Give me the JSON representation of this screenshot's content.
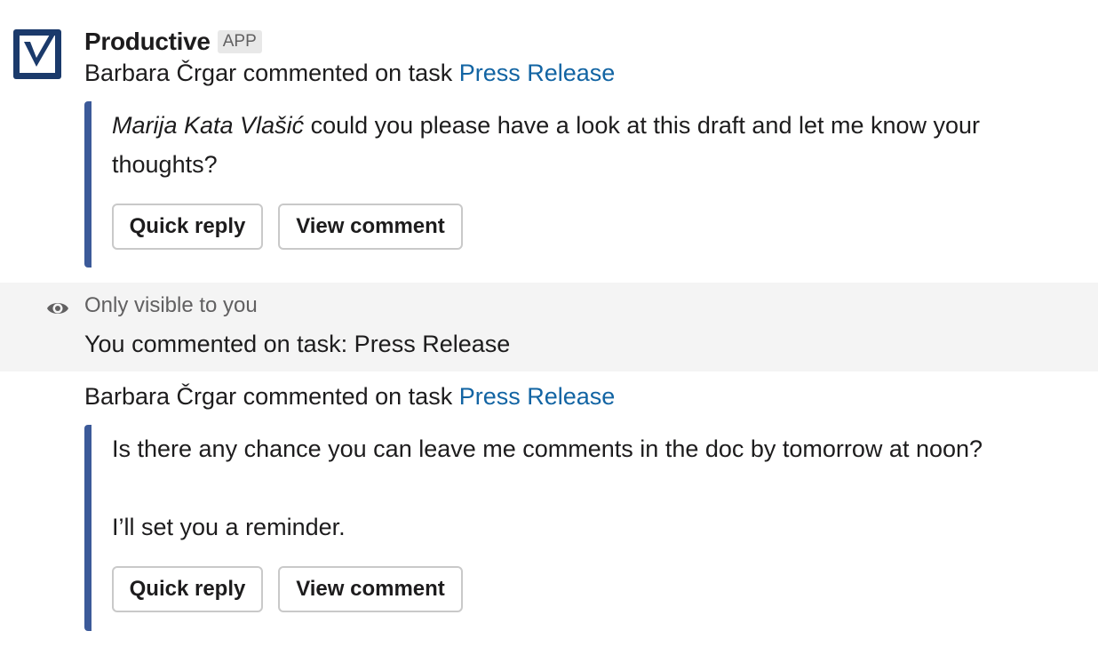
{
  "message1": {
    "sender": "Productive",
    "badge": "APP",
    "line_prefix": "Barbara Črgar commented on task ",
    "task_link": "Press Release",
    "mention": "Marija Kata Vlašić",
    "comment_rest": " could you please have a look at this draft and let me know your thoughts?",
    "quick_reply_label": "Quick reply",
    "view_comment_label": "View comment"
  },
  "ephemeral": {
    "visibility_note": "Only visible to you",
    "text": "You commented on task: Press Release"
  },
  "message2": {
    "line_prefix": "Barbara Črgar commented on task ",
    "task_link": "Press Release",
    "comment_line1": "Is there any chance you can leave me comments in the doc by tomorrow at noon?",
    "comment_line2": "I’ll set you a reminder.",
    "quick_reply_label": "Quick reply",
    "view_comment_label": "View comment"
  },
  "colors": {
    "link": "#1264a3",
    "attachment_bar": "#3c5a99",
    "logo": "#1b3a6b"
  }
}
